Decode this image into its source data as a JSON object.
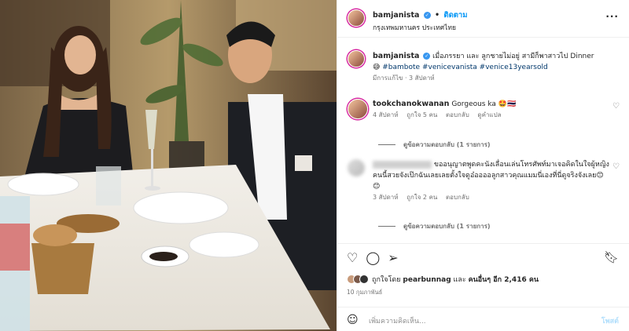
{
  "post": {
    "username": "bamjanista",
    "follow_label": "ติดตาม",
    "location": "กรุงเทพมหานคร ประเทศไทย",
    "caption_text": "เมื่อภรรยา และ ลูกชายไม่อยู่ สามีก็พาสาวไป Dinner",
    "caption_emoji": "😅",
    "hashtags": "#bambote #venicevanista #venice13yearsold",
    "caption_meta": "มีการแก้ไข · 3 สัปดาห์"
  },
  "comments": [
    {
      "username": "tookchanokwanan",
      "text": "Gorgeous ka 🤩🇹🇭",
      "time": "4 สัปดาห์",
      "likes": "ถูกใจ 5 คน",
      "reply": "ตอบกลับ",
      "translate": "ดูคำแปล",
      "view_replies": "ดูข้อความตอบกลับ (1 รายการ)"
    },
    {
      "username": "",
      "text": "ขออนุญาตพูดคะนังเลื่อนเล่นโทรศัพท์มาเจอคิดในใจผู้หญิงคนนี้สวยจังเป๊กฉันเลยเลยตั้งใจดูอ๋ออออลูกสาวคุณแมมนี่เองที่นี่ดูจริงจังเลย😊😊",
      "time": "3 สัปดาห์",
      "likes": "ถูกใจ 2 คน",
      "reply": "ตอบกลับ",
      "view_replies": "ดูข้อความตอบกลับ (1 รายการ)"
    }
  ],
  "actions": {
    "liked_by_prefix": "ถูกใจโดย",
    "liked_by_user": "pearbunnag",
    "liked_by_mid": "และ",
    "liked_by_others": "คนอื่นๆ อีก 2,416 คน",
    "date": "10 กุมภาพันธ์",
    "comment_placeholder": "เพิ่มความคิดเห็น...",
    "post_label": "โพสต์"
  },
  "icons": {
    "like": "heart-icon",
    "comment": "comment-icon",
    "share": "share-icon",
    "save": "bookmark-icon",
    "emoji": "emoji-icon",
    "more": "more-icon"
  }
}
